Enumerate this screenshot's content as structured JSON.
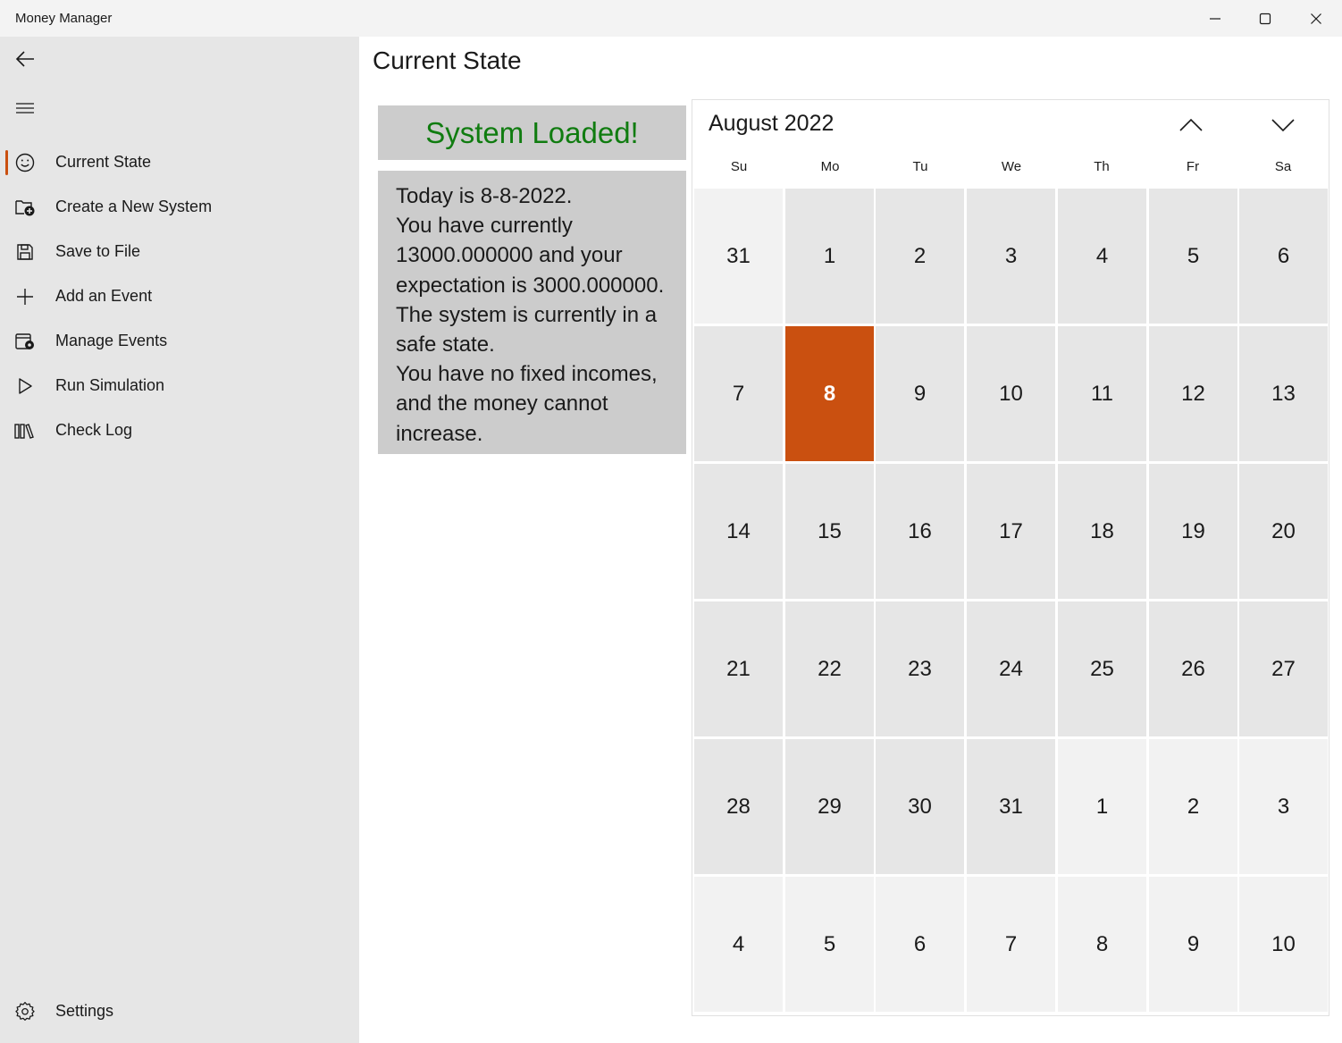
{
  "window": {
    "title": "Money Manager",
    "controls": {
      "minimize": "minimize-icon",
      "maximize": "maximize-icon",
      "close": "close-icon"
    }
  },
  "sidebar": {
    "back_icon": "back-arrow-icon",
    "menu_icon": "hamburger-icon",
    "items": [
      {
        "label": "Current State",
        "icon": "smiley-icon",
        "selected": true
      },
      {
        "label": "Create a New System",
        "icon": "folder-add-icon",
        "selected": false
      },
      {
        "label": "Save to File",
        "icon": "save-icon",
        "selected": false
      },
      {
        "label": "Add an Event",
        "icon": "plus-icon",
        "selected": false
      },
      {
        "label": "Manage Events",
        "icon": "calendar-settings-icon",
        "selected": false
      },
      {
        "label": "Run Simulation",
        "icon": "play-icon",
        "selected": false
      },
      {
        "label": "Check Log",
        "icon": "library-icon",
        "selected": false
      }
    ],
    "settings": {
      "label": "Settings",
      "icon": "gear-icon"
    },
    "accent_color": "#ca5010"
  },
  "main": {
    "title": "Current State",
    "status": {
      "text": "System Loaded!",
      "color": "#107c10"
    },
    "info_lines": [
      "Today is 8-8-2022.",
      "You have currently",
      "13000.000000 and your",
      "expectation is 3000.000000.",
      "The system is currently in a",
      "safe state.",
      "You have no fixed incomes,",
      "and the money cannot",
      "increase."
    ]
  },
  "calendar": {
    "month_label": "August 2022",
    "prev_icon": "chevron-up-icon",
    "next_icon": "chevron-down-icon",
    "weekdays": [
      "Su",
      "Mo",
      "Tu",
      "We",
      "Th",
      "Fr",
      "Sa"
    ],
    "today_color": "#ca5010",
    "weeks": [
      [
        {
          "d": "31",
          "in": false
        },
        {
          "d": "1",
          "in": true
        },
        {
          "d": "2",
          "in": true
        },
        {
          "d": "3",
          "in": true
        },
        {
          "d": "4",
          "in": true
        },
        {
          "d": "5",
          "in": true
        },
        {
          "d": "6",
          "in": true
        }
      ],
      [
        {
          "d": "7",
          "in": true
        },
        {
          "d": "8",
          "in": true,
          "today": true
        },
        {
          "d": "9",
          "in": true
        },
        {
          "d": "10",
          "in": true
        },
        {
          "d": "11",
          "in": true
        },
        {
          "d": "12",
          "in": true
        },
        {
          "d": "13",
          "in": true
        }
      ],
      [
        {
          "d": "14",
          "in": true
        },
        {
          "d": "15",
          "in": true
        },
        {
          "d": "16",
          "in": true
        },
        {
          "d": "17",
          "in": true
        },
        {
          "d": "18",
          "in": true
        },
        {
          "d": "19",
          "in": true
        },
        {
          "d": "20",
          "in": true
        }
      ],
      [
        {
          "d": "21",
          "in": true
        },
        {
          "d": "22",
          "in": true
        },
        {
          "d": "23",
          "in": true
        },
        {
          "d": "24",
          "in": true
        },
        {
          "d": "25",
          "in": true
        },
        {
          "d": "26",
          "in": true
        },
        {
          "d": "27",
          "in": true
        }
      ],
      [
        {
          "d": "28",
          "in": true
        },
        {
          "d": "29",
          "in": true
        },
        {
          "d": "30",
          "in": true
        },
        {
          "d": "31",
          "in": true
        },
        {
          "d": "1",
          "in": false
        },
        {
          "d": "2",
          "in": false
        },
        {
          "d": "3",
          "in": false
        }
      ],
      [
        {
          "d": "4",
          "in": false
        },
        {
          "d": "5",
          "in": false
        },
        {
          "d": "6",
          "in": false
        },
        {
          "d": "7",
          "in": false
        },
        {
          "d": "8",
          "in": false
        },
        {
          "d": "9",
          "in": false
        },
        {
          "d": "10",
          "in": false
        }
      ]
    ]
  }
}
